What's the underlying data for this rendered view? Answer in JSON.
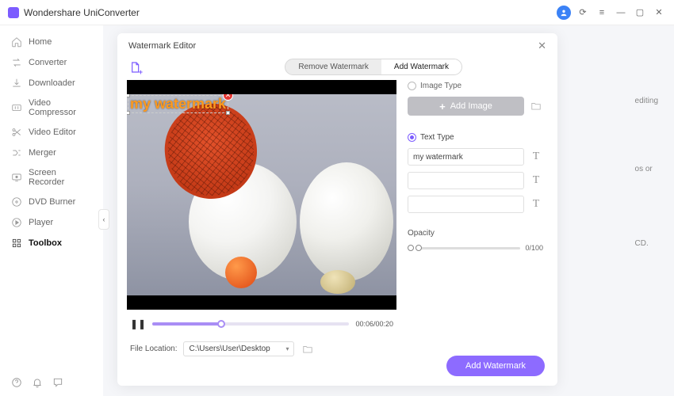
{
  "app": {
    "title": "Wondershare UniConverter"
  },
  "window": {
    "min": "—",
    "max": "▢",
    "close": "✕",
    "menu": "≡",
    "refresh": "⟳"
  },
  "sidebar": {
    "items": [
      {
        "label": "Home"
      },
      {
        "label": "Converter"
      },
      {
        "label": "Downloader"
      },
      {
        "label": "Video Compressor"
      },
      {
        "label": "Video Editor"
      },
      {
        "label": "Merger"
      },
      {
        "label": "Screen Recorder"
      },
      {
        "label": "DVD Burner"
      },
      {
        "label": "Player"
      },
      {
        "label": "Toolbox"
      }
    ],
    "collapse": "‹"
  },
  "bg": {
    "l1": "editing",
    "l2": "os or",
    "l3": "CD."
  },
  "modal": {
    "title": "Watermark Editor",
    "tabs": {
      "remove": "Remove Watermark",
      "add": "Add Watermark"
    },
    "watermark_text": "my watermark",
    "time": "00:06/00:20",
    "pause": "❚❚",
    "file_loc_label": "File Location:",
    "file_loc_value": "C:\\Users\\User\\Desktop",
    "panel": {
      "image_type": "Image Type",
      "add_image": "Add Image",
      "text_type": "Text Type",
      "text_value": "my watermark",
      "opacity_label": "Opacity",
      "opacity_value": "0/100"
    },
    "submit": "Add Watermark"
  }
}
